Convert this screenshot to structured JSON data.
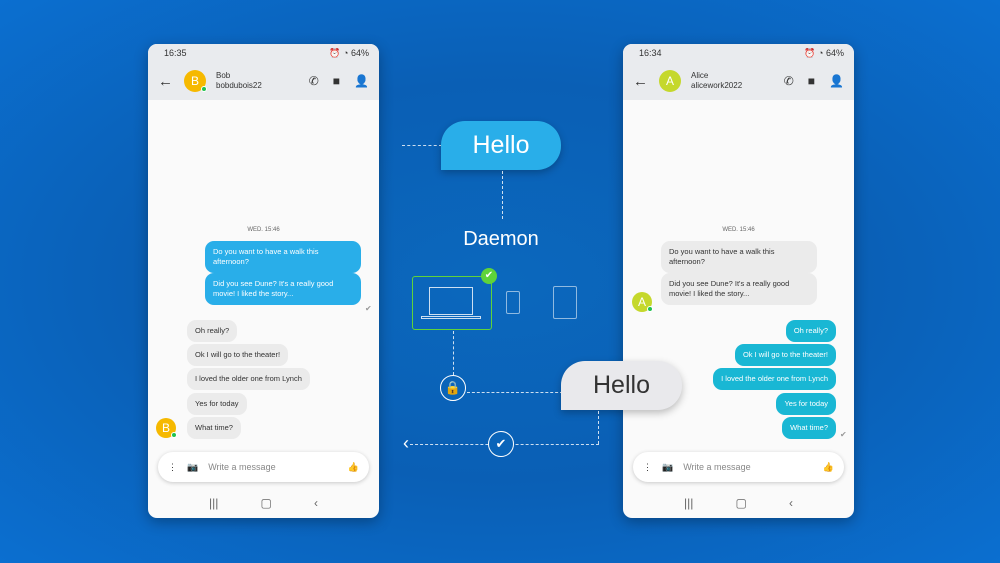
{
  "left_phone": {
    "status": {
      "time": "16:35",
      "right": "64%"
    },
    "contact": {
      "initial": "B",
      "name": "Bob",
      "username": "bobdubois22",
      "avatar_color": "#f6b900"
    },
    "date": "WED. 15:46",
    "sent": [
      "Do you want to have a walk this afternoon?",
      "Did you see Dune? It's a really good movie! I liked the story..."
    ],
    "received": [
      "Oh really?",
      "Ok I will go to the theater!",
      "I loved the older one from Lynch",
      "Yes for today",
      "What time?"
    ],
    "input_placeholder": "Write a message"
  },
  "right_phone": {
    "status": {
      "time": "16:34",
      "right": "64%"
    },
    "contact": {
      "initial": "A",
      "name": "Alice",
      "username": "alicework2022",
      "avatar_color": "#c5d82c"
    },
    "date": "WED. 15:46",
    "received": [
      "Do you want to have a walk this afternoon?",
      "Did you see Dune? It's a really good movie! I liked the story..."
    ],
    "sent": [
      "Oh really?",
      "Ok I will go to the theater!",
      "I loved the older one from Lynch",
      "Yes for today",
      "What time?"
    ],
    "input_placeholder": "Write a message"
  },
  "diagram": {
    "hello_top": "Hello",
    "daemon": "Daemon",
    "hello_bottom": "Hello"
  },
  "colors": {
    "sent_left": "#29aee9",
    "sent_right": "#19b7d4",
    "device_selected": "#5fd33a"
  }
}
